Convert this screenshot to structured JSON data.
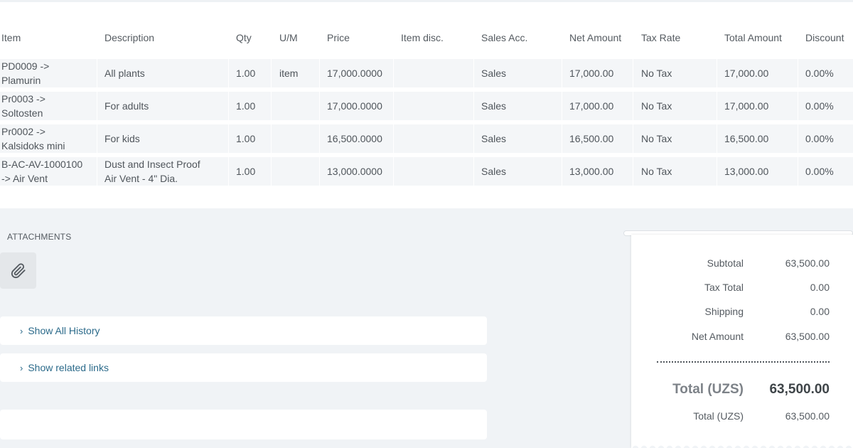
{
  "table": {
    "headers": {
      "item": "Item",
      "description": "Description",
      "qty": "Qty",
      "um": "U/M",
      "price": "Price",
      "item_disc": "Item disc.",
      "sales_acc": "Sales Acc.",
      "net_amount": "Net Amount",
      "tax_rate": "Tax Rate",
      "total_amount": "Total Amount",
      "discount": "Discount"
    },
    "rows": [
      {
        "item": "PD0009 ->\nPlamurin",
        "description": "All plants",
        "qty": "1.00",
        "um": "item",
        "price": "17,000.0000",
        "item_disc": "",
        "sales_acc": "Sales",
        "net_amount": "17,000.00",
        "tax_rate": "No Tax",
        "total_amount": "17,000.00",
        "discount": "0.00%"
      },
      {
        "item": "Pr0003 ->\nSoltosten",
        "description": "For adults",
        "qty": "1.00",
        "um": "",
        "price": "17,000.0000",
        "item_disc": "",
        "sales_acc": "Sales",
        "net_amount": "17,000.00",
        "tax_rate": "No Tax",
        "total_amount": "17,000.00",
        "discount": "0.00%"
      },
      {
        "item": "Pr0002 ->\nKalsidoks mini",
        "description": "For kids",
        "qty": "1.00",
        "um": "",
        "price": "16,500.0000",
        "item_disc": "",
        "sales_acc": "Sales",
        "net_amount": "16,500.00",
        "tax_rate": "No Tax",
        "total_amount": "16,500.00",
        "discount": "0.00%"
      },
      {
        "item": "B-AC-AV-1000100\n-> Air Vent",
        "description": "Dust and Insect Proof\nAir Vent - 4\" Dia.",
        "qty": "1.00",
        "um": "",
        "price": "13,000.0000",
        "item_disc": "",
        "sales_acc": "Sales",
        "net_amount": "13,000.00",
        "tax_rate": "No Tax",
        "total_amount": "13,000.00",
        "discount": "0.00%"
      }
    ]
  },
  "attachments": {
    "label": "ATTACHMENTS",
    "icon": "paperclip-icon"
  },
  "sections": {
    "history": {
      "label": "Show All History",
      "icon": "chevron-right-icon"
    },
    "related": {
      "label": "Show related links",
      "icon": "chevron-right-icon"
    }
  },
  "totals": {
    "subtotal": {
      "label": "Subtotal",
      "value": "63,500.00"
    },
    "tax_total": {
      "label": "Tax Total",
      "value": "0.00"
    },
    "shipping": {
      "label": "Shipping",
      "value": "0.00"
    },
    "net_amount": {
      "label": "Net Amount",
      "value": "63,500.00"
    },
    "grand_total": {
      "label": "Total (UZS)",
      "value": "63,500.00"
    },
    "total_secondary": {
      "label": "Total (UZS)",
      "value": "63,500.00"
    }
  },
  "colors": {
    "background": "#f0f3f6",
    "row_background": "#f4f6f8",
    "link": "#2b6a8a",
    "text": "#4f555b"
  }
}
